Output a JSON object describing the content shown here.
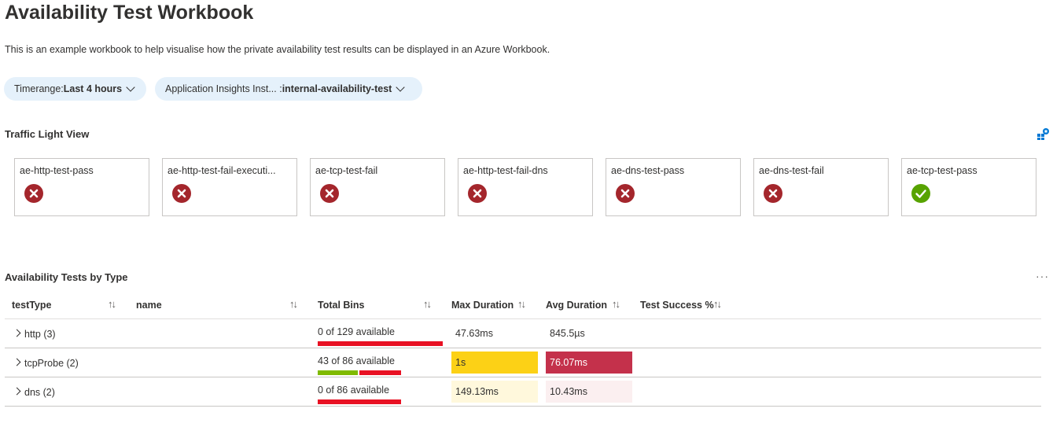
{
  "header": {
    "title": "Availability Test Workbook",
    "description": "This is an example workbook to help visualise how the private availability test results can be displayed in an Azure Workbook."
  },
  "parameters": {
    "timerange": {
      "label": "Timerange: ",
      "value": "Last 4 hours"
    },
    "app_insights": {
      "label": "Application Insights Inst... : ",
      "value": "internal-availability-test"
    }
  },
  "traffic_light": {
    "title": "Traffic Light View",
    "tiles": [
      {
        "name": "ae-http-test-pass",
        "status": "fail"
      },
      {
        "name": "ae-http-test-fail-executi...",
        "status": "fail"
      },
      {
        "name": "ae-tcp-test-fail",
        "status": "fail"
      },
      {
        "name": "ae-http-test-fail-dns",
        "status": "fail"
      },
      {
        "name": "ae-dns-test-pass",
        "status": "fail"
      },
      {
        "name": "ae-dns-test-fail",
        "status": "fail"
      },
      {
        "name": "ae-tcp-test-pass",
        "status": "pass"
      }
    ]
  },
  "table": {
    "title": "Availability Tests by Type",
    "columns": [
      "testType",
      "name",
      "Total Bins",
      "Max Duration",
      "Avg Duration",
      "Test Success %"
    ],
    "rows": [
      {
        "testType": "http (3)",
        "bins": "0 of 129 available",
        "bins_available_fraction": 0,
        "max_duration": "47.63ms",
        "avg_duration": "845.5µs"
      },
      {
        "testType": "tcpProbe (2)",
        "bins": "43 of 86 available",
        "bins_available_fraction": 0.5,
        "max_duration": "1s",
        "avg_duration": "76.07ms"
      },
      {
        "testType": "dns (2)",
        "bins": "0 of 86 available",
        "bins_available_fraction": 0,
        "max_duration": "149.13ms",
        "avg_duration": "10.43ms"
      }
    ]
  },
  "colors": {
    "fail": "#a4262c",
    "pass": "#57a300",
    "bar_red": "#e81123",
    "bar_green": "#7fba00",
    "heat_yellow": "#fcd116",
    "heat_red": "#c4314b",
    "heat_yellow_light": "#fff8dc",
    "heat_red_light": "#fbeff0"
  }
}
